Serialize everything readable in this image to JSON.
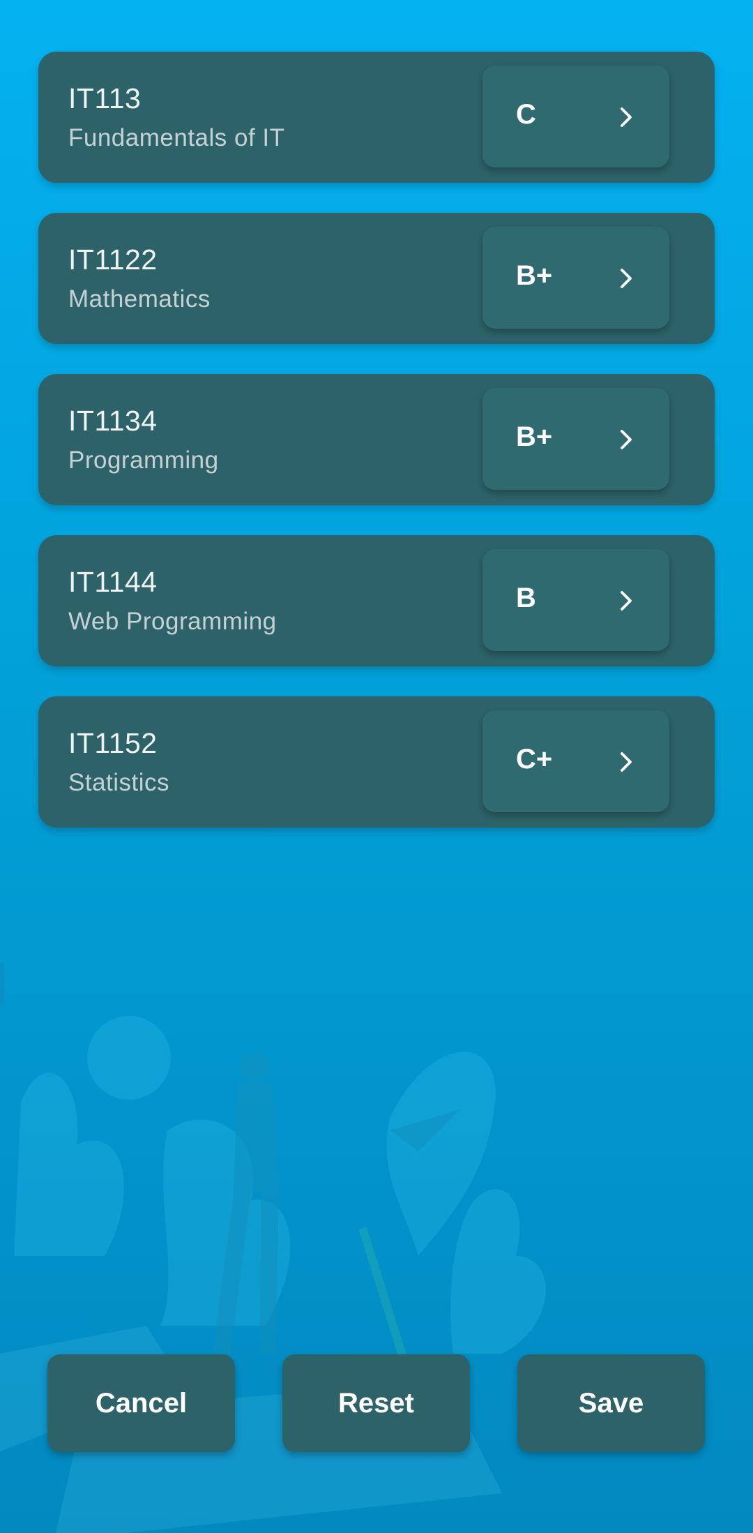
{
  "courses": [
    {
      "code": "IT113",
      "name": "Fundamentals of IT",
      "grade": "C"
    },
    {
      "code": "IT1122",
      "name": "Mathematics",
      "grade": "B+"
    },
    {
      "code": "IT1134",
      "name": "Programming",
      "grade": "B+"
    },
    {
      "code": "IT1144",
      "name": "Web Programming",
      "grade": "B"
    },
    {
      "code": "IT1152",
      "name": "Statistics",
      "grade": "C+"
    }
  ],
  "actions": {
    "cancel_label": "Cancel",
    "reset_label": "Reset",
    "save_label": "Save"
  },
  "colors": {
    "background_top": "#04b1f0",
    "background_bottom": "#0289c0",
    "card": "#2c6268",
    "text_primary": "#ffffff"
  },
  "icons": {
    "grade_dropdown": "chevron-right-icon",
    "background": "student-illustration"
  }
}
